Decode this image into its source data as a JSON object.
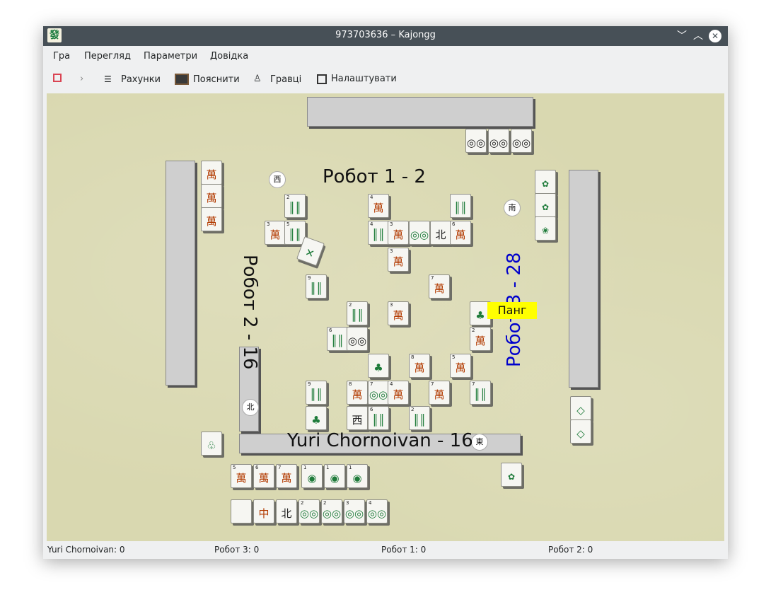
{
  "window": {
    "title": "973703636 – Kajongg",
    "app_icon_glyph": "發"
  },
  "menu": {
    "items": [
      "Гра",
      "Перегляд",
      "Параметри",
      "Довідка"
    ]
  },
  "toolbar": {
    "scores": "Рахунки",
    "explain": "Пояснити",
    "players": "Гравці",
    "configure": "Налаштувати"
  },
  "board": {
    "players": {
      "north": "Робот 1 - 2",
      "west": "Робот 2 - 16",
      "east": "Робот 3 - 28",
      "south": "Yuri Chornoivan - 16"
    },
    "claim_bubble": "Панг",
    "winds": {
      "north": "西",
      "east": "南",
      "west": "北",
      "south": "東"
    }
  },
  "status": {
    "p1": "Yuri Chornoivan: 0",
    "p2": "Робот 3: 0",
    "p3": "Робот 1: 0",
    "p4": "Робот 2: 0"
  },
  "colors": {
    "titlebar": "#475057",
    "board": "#d9d8b0",
    "east_label": "#0000cc",
    "claim": "#ffff00",
    "character_red": "#b23a00",
    "bamboo_green": "#1e7b3a"
  },
  "tiles": {
    "wan": "萬",
    "three": "三",
    "four": "四",
    "five": "伍",
    "six": "六",
    "seven": "七",
    "eight": "八",
    "north": "北",
    "west": "西",
    "red": "中",
    "bamboo": "║║",
    "circles": "◎◎",
    "dots": "◉"
  }
}
